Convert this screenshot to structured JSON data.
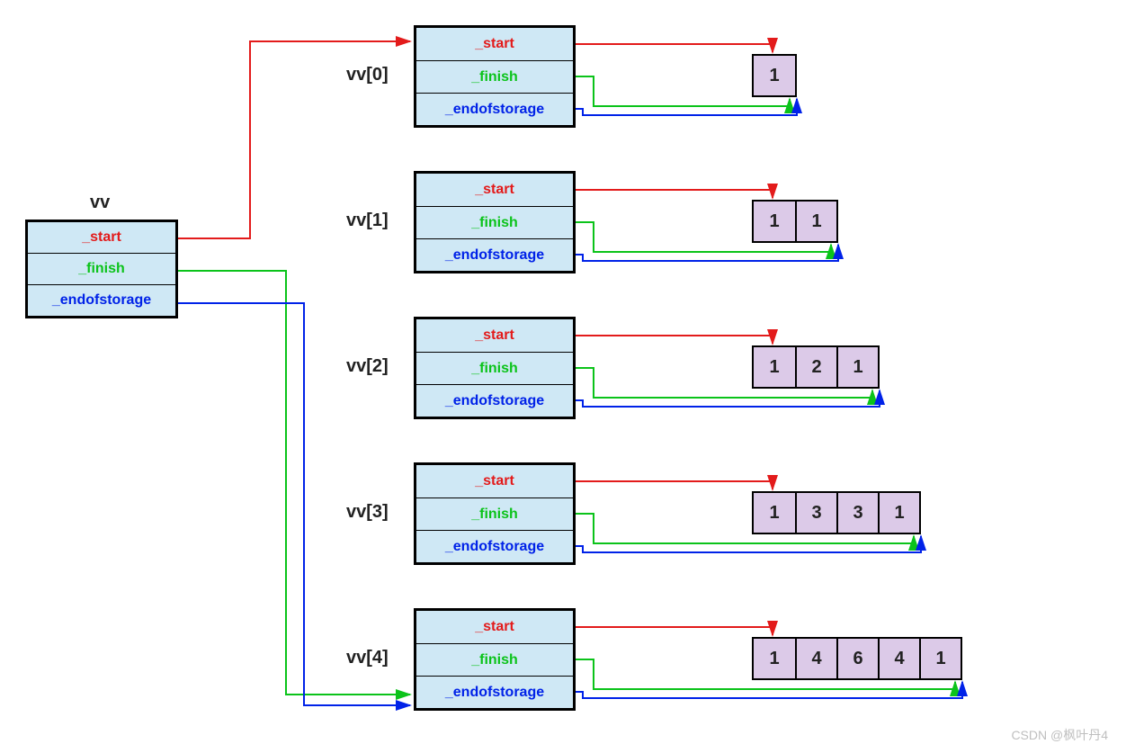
{
  "colors": {
    "red": "#e31b1b",
    "green": "#0bc31a",
    "blue": "#0022e8",
    "boxFill": "#cfe8f5",
    "cellFill": "#dccae8"
  },
  "fields": {
    "start": "_start",
    "finish": "_finish",
    "end": "_endofstorage"
  },
  "root": {
    "label": "vv"
  },
  "rows": [
    {
      "label": "vv[0]",
      "values": [
        "1"
      ]
    },
    {
      "label": "vv[1]",
      "values": [
        "1",
        "1"
      ]
    },
    {
      "label": "vv[2]",
      "values": [
        "1",
        "2",
        "1"
      ]
    },
    {
      "label": "vv[3]",
      "values": [
        "1",
        "3",
        "3",
        "1"
      ]
    },
    {
      "label": "vv[4]",
      "values": [
        "1",
        "4",
        "6",
        "4",
        "1"
      ]
    }
  ],
  "watermark": "CSDN @枫叶丹4"
}
